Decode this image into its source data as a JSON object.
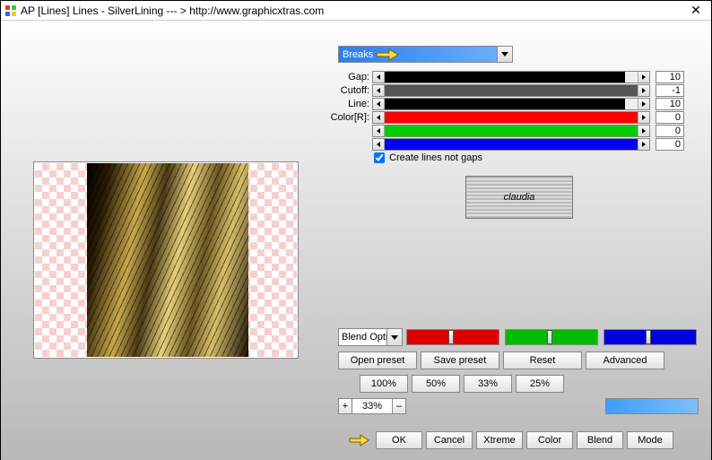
{
  "window": {
    "title": "AP [Lines]  Lines - SilverLining    --- > http://www.graphicxtras.com",
    "close": "✕"
  },
  "combo": {
    "selected": "Breaks"
  },
  "params": {
    "rows": [
      {
        "label": "Gap:",
        "value": "10",
        "fill": "#000",
        "pct": 95
      },
      {
        "label": "Cutoff:",
        "value": "-1",
        "fill": "#555",
        "pct": 100,
        "dark": true
      },
      {
        "label": "Line:",
        "value": "10",
        "fill": "#000",
        "pct": 95
      },
      {
        "label": "Color[R]:",
        "value": "0",
        "fill": "#f00",
        "pct": 100
      },
      {
        "label": "",
        "value": "0",
        "fill": "#0c0",
        "pct": 100
      },
      {
        "label": "",
        "value": "0",
        "fill": "#00f",
        "pct": 100
      }
    ]
  },
  "checkbox": {
    "label": "Create lines not gaps",
    "checked": true
  },
  "logo": {
    "text": "claudia"
  },
  "blendSelect": {
    "label": "Blend Optic"
  },
  "rgbSliders": [
    {
      "bg": "#d00",
      "knob": 46
    },
    {
      "bg": "#0b0",
      "knob": 46
    },
    {
      "bg": "#00d",
      "knob": 46
    }
  ],
  "presets": {
    "open": "Open preset",
    "save": "Save preset",
    "reset": "Reset",
    "adv": "Advanced"
  },
  "zoom": {
    "z100": "100%",
    "z50": "50%",
    "z33": "33%",
    "z25": "25%"
  },
  "spinner": {
    "plus": "+",
    "value": "33%",
    "minus": "–"
  },
  "bottom": {
    "ok": "OK",
    "cancel": "Cancel",
    "xtreme": "Xtreme",
    "color": "Color",
    "blend": "Blend",
    "mode": "Mode"
  }
}
